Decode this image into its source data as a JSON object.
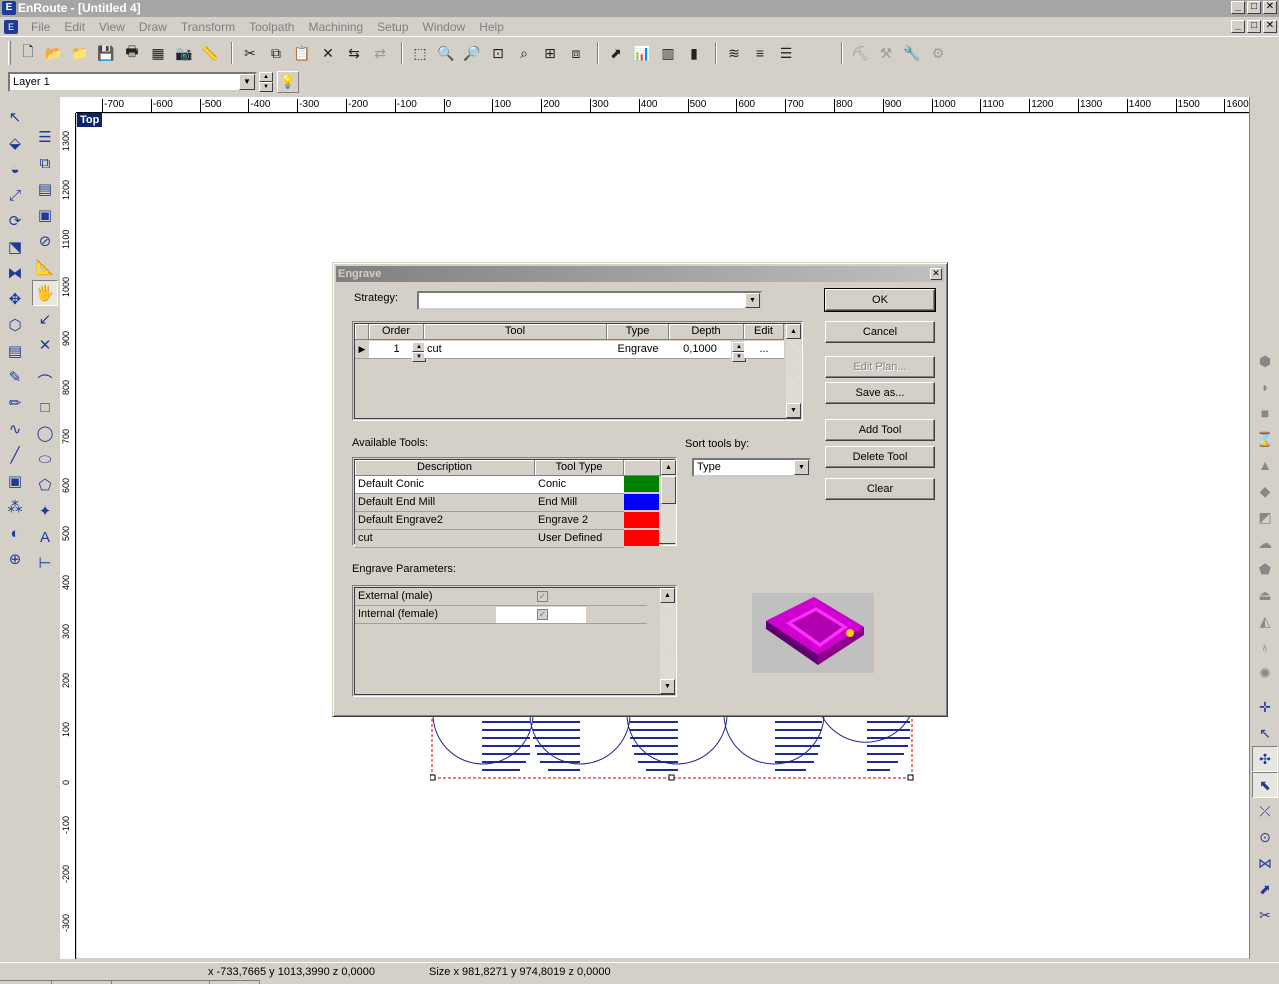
{
  "window": {
    "title": "EnRoute - [Untitled 4]",
    "min": "_",
    "max": "□",
    "close": "✕"
  },
  "menu": {
    "items": [
      {
        "label": "File"
      },
      {
        "label": "Edit"
      },
      {
        "label": "View"
      },
      {
        "label": "Draw"
      },
      {
        "label": "Transform"
      },
      {
        "label": "Toolpath"
      },
      {
        "label": "Machining"
      },
      {
        "label": "Setup"
      },
      {
        "label": "Window"
      },
      {
        "label": "Help"
      }
    ]
  },
  "layer": {
    "selected": "Layer 1"
  },
  "canvas": {
    "view_label": "Top",
    "hticks": [
      "-700",
      "-600",
      "-500",
      "-400",
      "-300",
      "-200",
      "-100",
      "0",
      "100",
      "200",
      "300",
      "400",
      "500",
      "600",
      "700",
      "800",
      "900",
      "1000",
      "1100",
      "1200",
      "1300",
      "1400",
      "1500",
      "1600"
    ],
    "vticks": [
      "1300",
      "1200",
      "1100",
      "1000",
      "900",
      "800",
      "700",
      "600",
      "500",
      "400",
      "300",
      "200",
      "100",
      "0",
      "-100",
      "-200",
      "-300"
    ]
  },
  "status": {
    "coords": "x -733,7665 y 1013,3990 z 0,0000",
    "size": "Size x 981,8271 y 974,8019 z 0,0000"
  },
  "dialog": {
    "title": "Engrave",
    "strategy_label": "Strategy:",
    "strategy_value": "",
    "plan_grid": {
      "headers": [
        "Order",
        "Tool",
        "Type",
        "Depth",
        "Edit"
      ],
      "rows": [
        {
          "order": "1",
          "tool": "cut",
          "type": "Engrave",
          "depth": "0,1000",
          "edit": "..."
        }
      ]
    },
    "available_tools_label": "Available Tools:",
    "tools_grid": {
      "headers": [
        "Description",
        "Tool Type"
      ],
      "rows": [
        {
          "description": "Default Conic",
          "type": "Conic",
          "color": "#008000"
        },
        {
          "description": "Default End Mill",
          "type": "End Mill",
          "color": "#0000ff"
        },
        {
          "description": "Default Engrave2",
          "type": "Engrave 2",
          "color": "#ff0000"
        },
        {
          "description": "cut",
          "type": "User Defined",
          "color": "#ff0000"
        }
      ]
    },
    "sort_label": "Sort tools by:",
    "sort_value": "Type",
    "params_label": "Engrave Parameters:",
    "params": [
      {
        "label": "External (male)",
        "checked": "✓"
      },
      {
        "label": "Internal (female)",
        "checked": "✓"
      }
    ],
    "buttons": {
      "ok": "OK",
      "cancel": "Cancel",
      "edit_plan": "Edit Plan...",
      "save_as": "Save as...",
      "add_tool": "Add Tool",
      "delete_tool": "Delete Tool",
      "clear": "Clear"
    }
  }
}
